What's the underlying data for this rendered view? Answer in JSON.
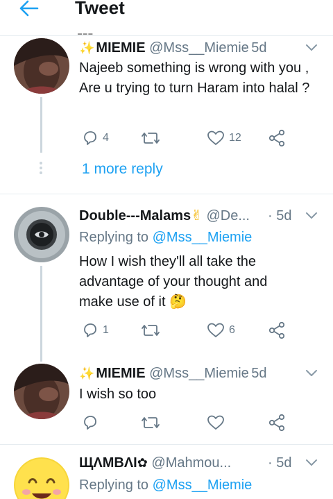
{
  "header": {
    "title": "Tweet"
  },
  "tweets": [
    {
      "name": "MIEMIE",
      "handle": "@Mss__Miemie",
      "time": "· 5d",
      "text": "Najeeb something is wrong with you , Are u trying to turn Haram into halal ?",
      "reply_count": "4",
      "retweet_count": "",
      "like_count": "12"
    },
    {
      "name": "Double---Malams",
      "handle": "@De...",
      "time": "· 5d",
      "replying_prefix": "Replying to",
      "replying_to": "@Mss__Miemie",
      "text": "How I wish they'll all take the advantage of your thought and make use of it",
      "reply_count": "1",
      "retweet_count": "",
      "like_count": "6"
    },
    {
      "name": "MIEMIE",
      "handle": "@Mss__Miemie",
      "time": "· 5d",
      "text": "I wish so too",
      "reply_count": "",
      "retweet_count": "",
      "like_count": ""
    },
    {
      "name": "ЩΛMBΛI",
      "handle": "@Mahmou...",
      "time": "· 5d",
      "replying_prefix": "Replying to",
      "replying_to": "@Mss__Miemie"
    }
  ],
  "thread": {
    "more_replies": "1 more reply"
  },
  "emoji": {
    "victory": "✌",
    "thinking": "🤔",
    "sparkles": "✨"
  },
  "colors": {
    "accent": "#1da1f2",
    "secondary_text": "#657786",
    "border": "#e6ecf0"
  }
}
